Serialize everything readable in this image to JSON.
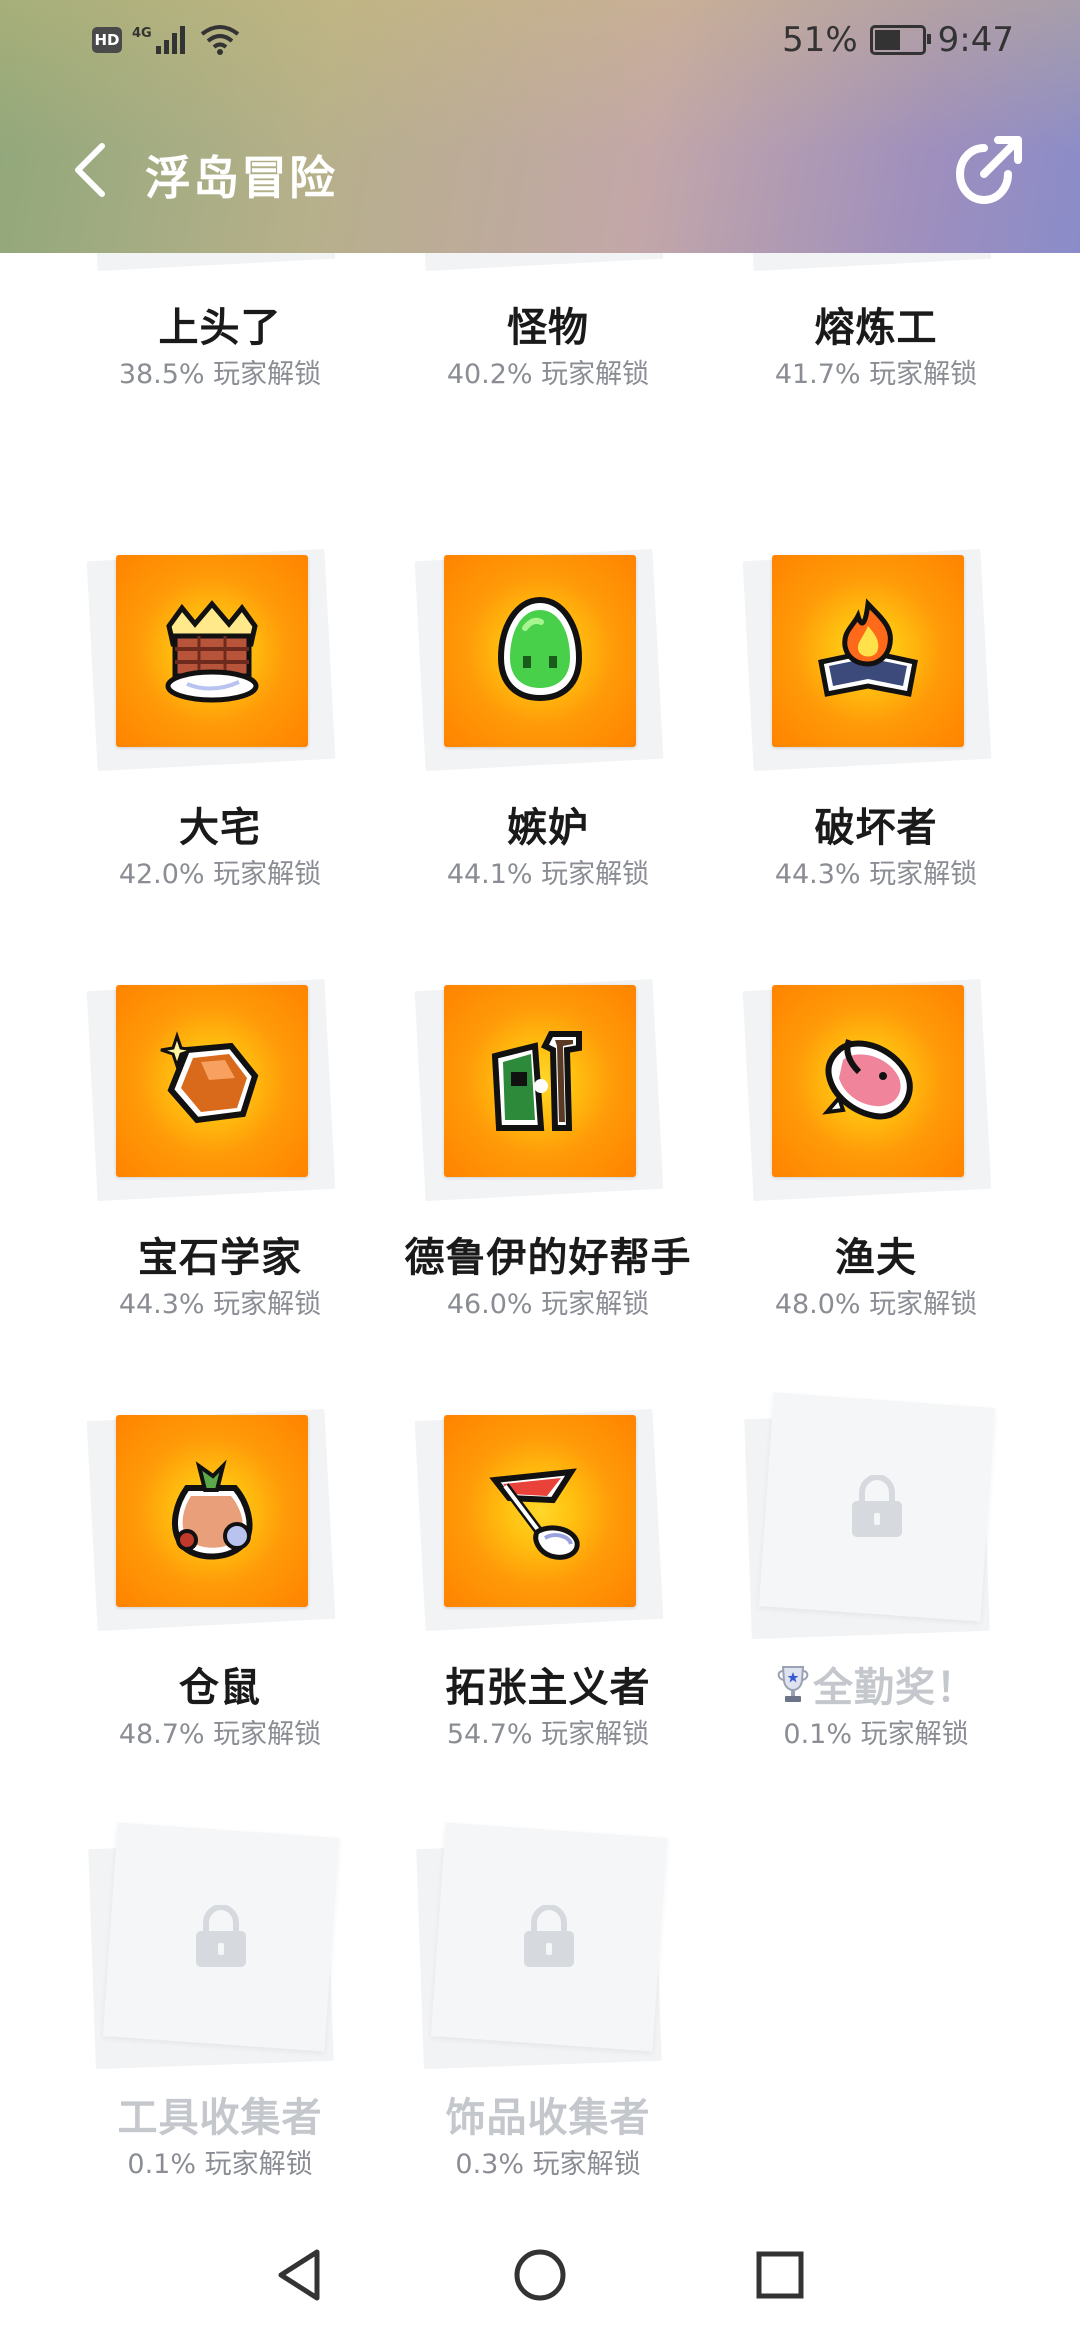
{
  "status_bar": {
    "hd_label": "HD",
    "network_label": "4G",
    "battery_text": "51%",
    "time": "9:47"
  },
  "header": {
    "title": "浮岛冒险"
  },
  "achievements": [
    {
      "name": "上头了",
      "rate": "38.5% 玩家解锁",
      "locked": false,
      "icon": "partial-icon"
    },
    {
      "name": "怪物",
      "rate": "40.2% 玩家解锁",
      "locked": false,
      "icon": "partial-icon"
    },
    {
      "name": "熔炼工",
      "rate": "41.7% 玩家解锁",
      "locked": false,
      "icon": "partial-icon"
    },
    {
      "name": "大宅",
      "rate": "42.0% 玩家解锁",
      "locked": false,
      "icon": "house-crown-icon"
    },
    {
      "name": "嫉妒",
      "rate": "44.1% 玩家解锁",
      "locked": false,
      "icon": "green-slime-icon"
    },
    {
      "name": "破坏者",
      "rate": "44.3% 玩家解锁",
      "locked": false,
      "icon": "burning-book-icon"
    },
    {
      "name": "宝石学家",
      "rate": "44.3% 玩家解锁",
      "locked": false,
      "icon": "gem-icon"
    },
    {
      "name": "德鲁伊的好帮手",
      "rate": "46.0% 玩家解锁",
      "locked": false,
      "icon": "druid-icon"
    },
    {
      "name": "渔夫",
      "rate": "48.0% 玩家解锁",
      "locked": false,
      "icon": "fish-icon"
    },
    {
      "name": "仓鼠",
      "rate": "48.7% 玩家解锁",
      "locked": false,
      "icon": "sack-icon"
    },
    {
      "name": "拓张主义者",
      "rate": "54.7% 玩家解锁",
      "locked": false,
      "icon": "flag-icon"
    },
    {
      "name": "全勤奖！",
      "rate": "0.1% 玩家解锁",
      "locked": true,
      "icon": "lock-icon",
      "trophy": true
    },
    {
      "name": "工具收集者",
      "rate": "0.1% 玩家解锁",
      "locked": true,
      "icon": "lock-icon"
    },
    {
      "name": "饰品收集者",
      "rate": "0.3% 玩家解锁",
      "locked": true,
      "icon": "lock-icon"
    }
  ],
  "colors": {
    "badge_orange": "#ff8a00",
    "badge_yellow": "#ffd82a",
    "locked_text": "#c4c7cc",
    "rate_text": "#8a8d93"
  }
}
